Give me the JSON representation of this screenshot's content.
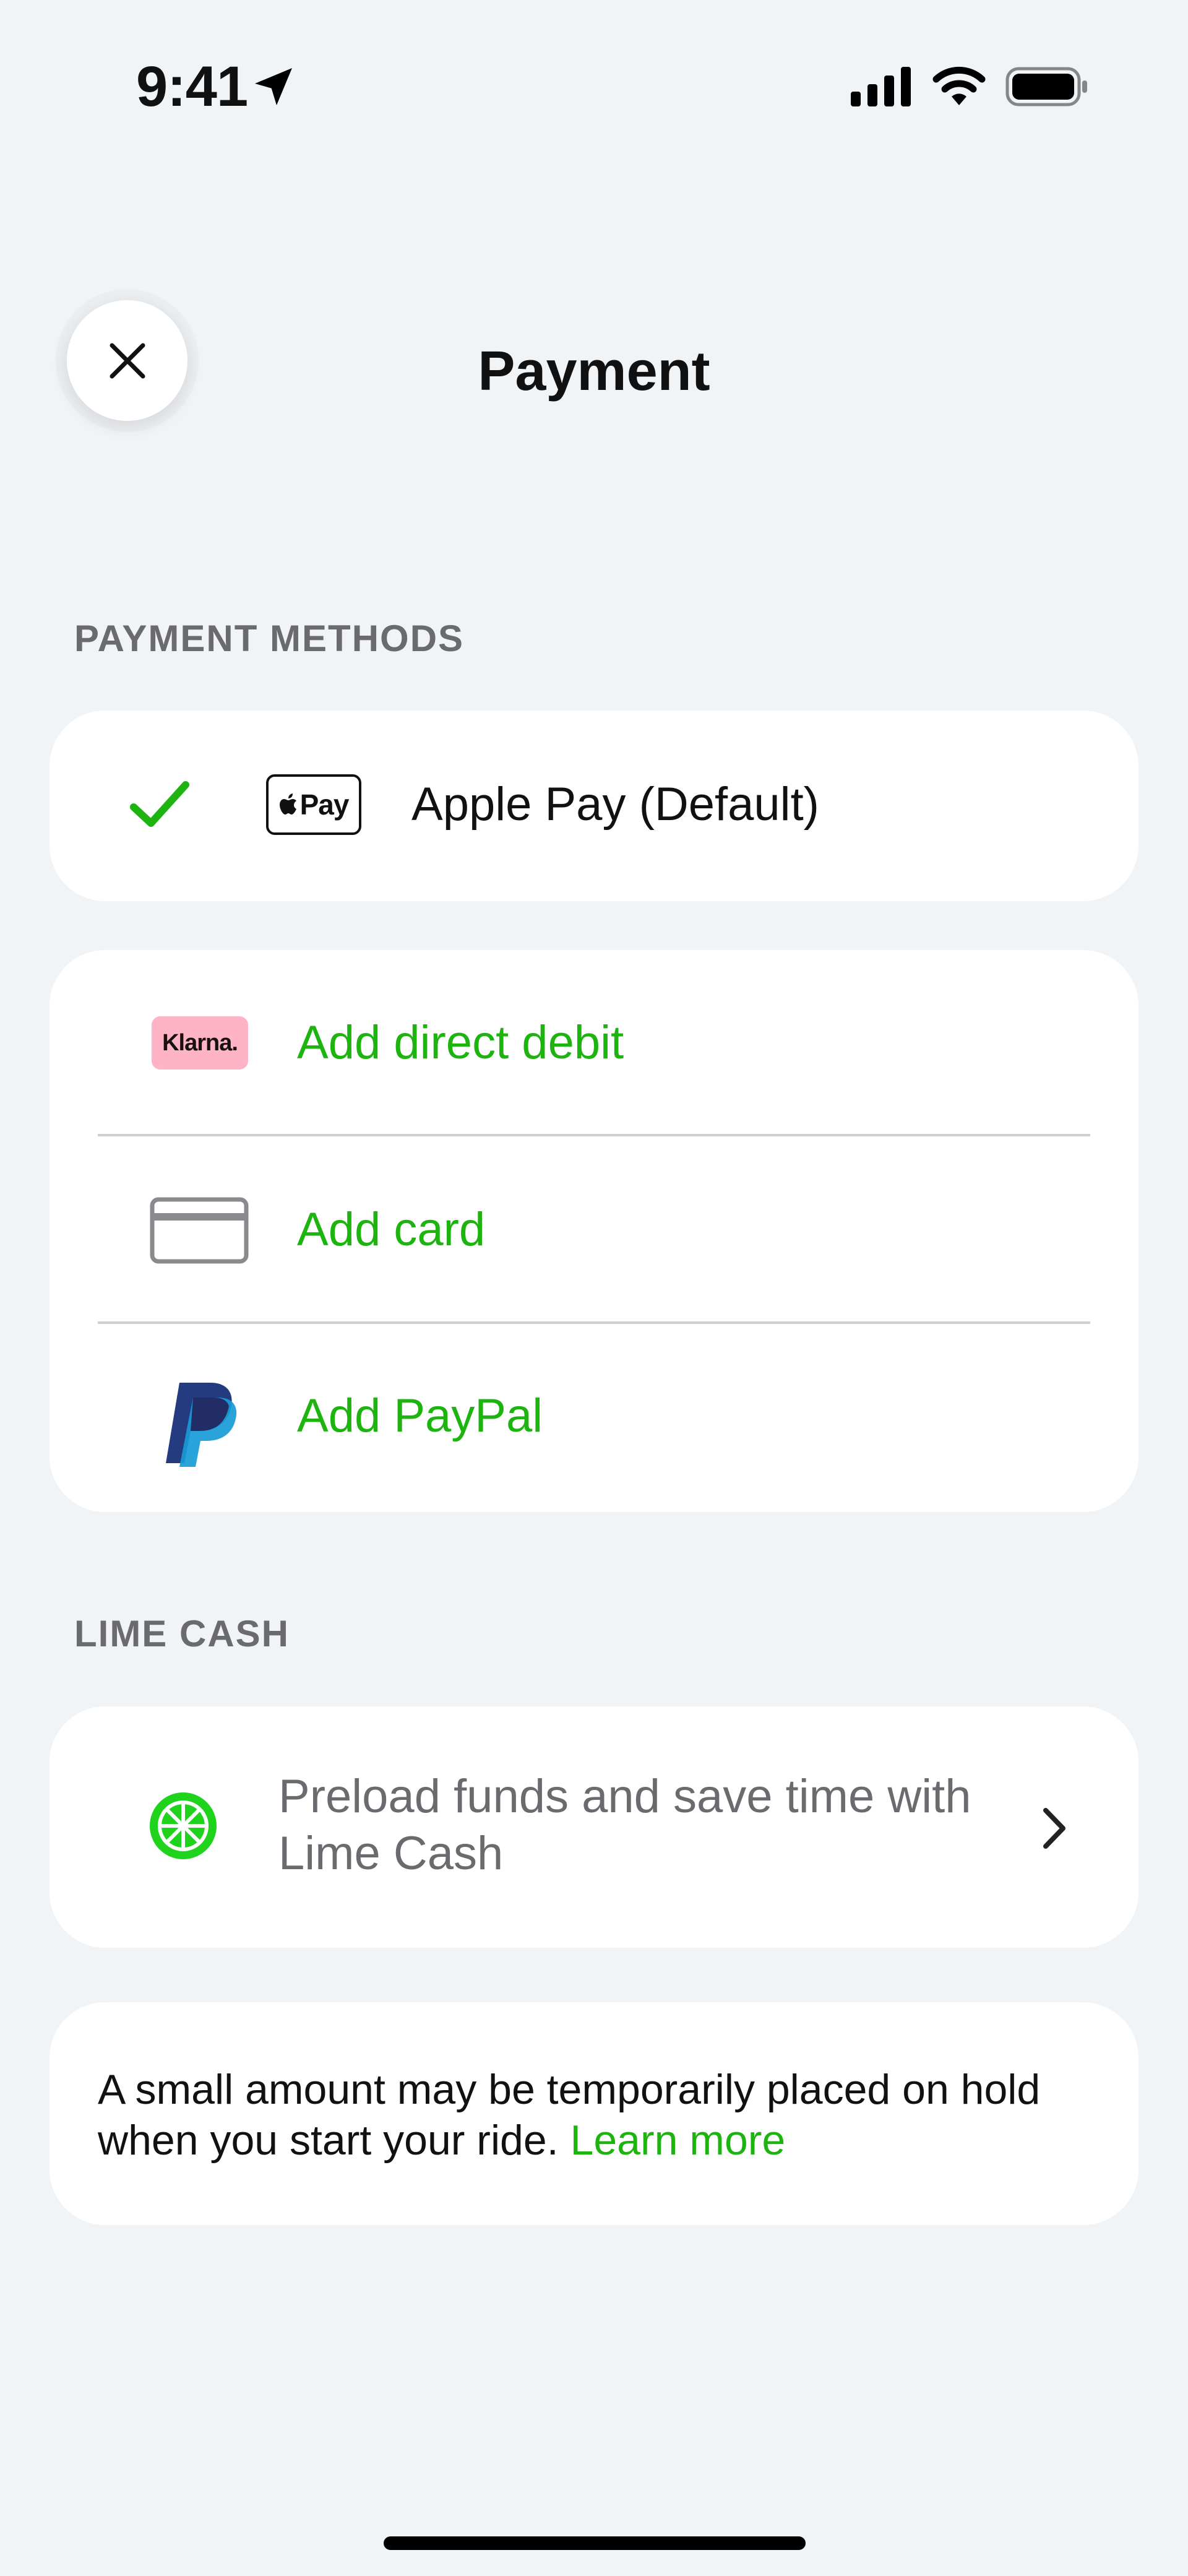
{
  "status_bar": {
    "time": "9:41"
  },
  "header": {
    "title": "Payment"
  },
  "payment_methods": {
    "section_label": "PAYMENT METHODS",
    "default_method": {
      "badge_text": "Pay",
      "label": "Apple Pay (Default)"
    },
    "add_options": [
      {
        "label": "Add direct debit",
        "icon_text": "Klarna."
      },
      {
        "label": "Add card"
      },
      {
        "label": "Add PayPal"
      }
    ]
  },
  "lime_cash": {
    "section_label": "LIME CASH",
    "promo_line1": "Preload funds and save time with",
    "promo_line2": "Lime Cash"
  },
  "hold_notice": {
    "line1": "A small amount may be temporarily placed on hold",
    "line2": "when you start your ride.",
    "link": "Learn more"
  },
  "colors": {
    "accent": "#1db40f",
    "background": "#f1f4f7",
    "klarna_pink": "#ffb3c7",
    "paypal_dark": "#253b80",
    "paypal_light": "#179bd7"
  }
}
